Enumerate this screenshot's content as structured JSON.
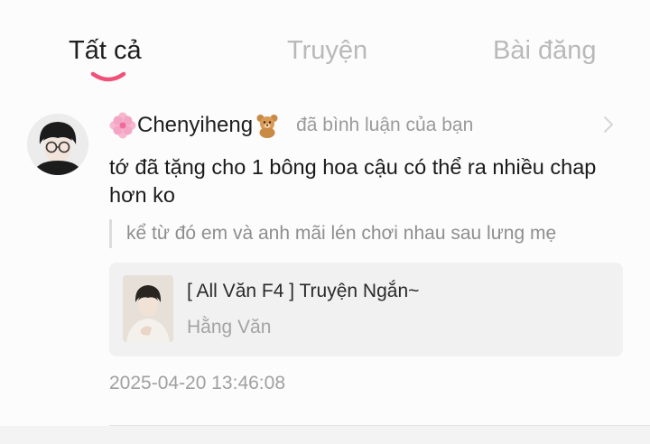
{
  "tabs": [
    {
      "label": "Tất cả",
      "active": true
    },
    {
      "label": "Truyện",
      "active": false
    },
    {
      "label": "Bài đăng",
      "active": false
    }
  ],
  "colors": {
    "accent": "#f0517a",
    "active_tab": "#1f1f1f",
    "inactive_tab": "#b9b9b9",
    "card_bg": "#f1f1f1"
  },
  "notification": {
    "username": "Chenyiheng",
    "username_prefix_icon": "flower-icon",
    "username_suffix_icon": "bear-icon",
    "action": "đã bình luận của bạn",
    "comment": "tớ đã tặng cho 1 bông hoa cậu có thể ra nhiều chap hơn ko",
    "quoted": "kể từ đó em và anh mãi lén chơi nhau sau lưng mẹ",
    "story": {
      "title": "[ All Văn F4 ] Truyện Ngắn~",
      "author": "Hằng Văn"
    },
    "timestamp": "2025-04-20 13:46:08"
  }
}
